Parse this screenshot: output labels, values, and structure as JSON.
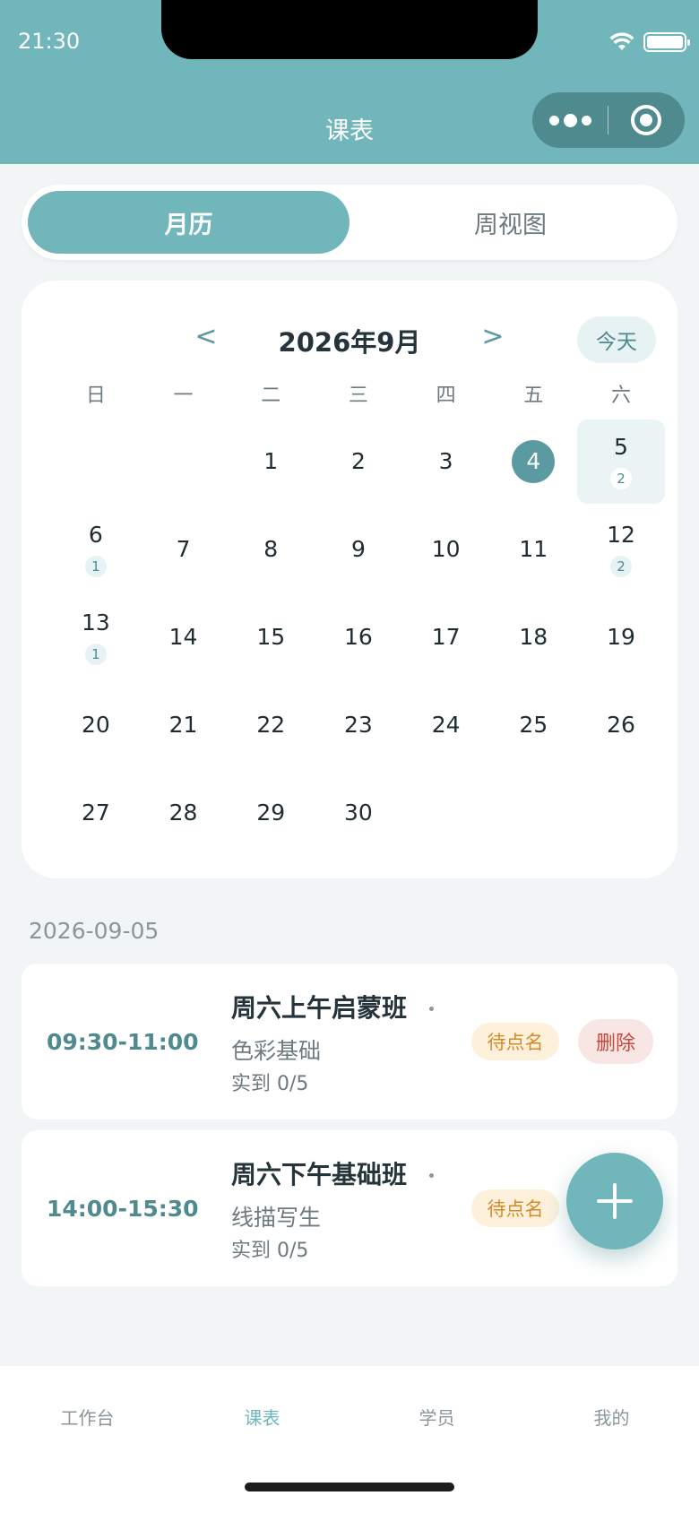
{
  "status_bar": {
    "time": "21:30"
  },
  "header": {
    "title": "课表"
  },
  "view_toggle": {
    "month_label": "月历",
    "week_label": "周视图",
    "active": "month"
  },
  "calendar": {
    "month_title": "2026年9月",
    "prev_symbol": "<",
    "next_symbol": ">",
    "today_label": "今天",
    "weekdays": [
      "日",
      "一",
      "二",
      "三",
      "四",
      "五",
      "六"
    ],
    "leading_blanks": 2,
    "days_in_month": 30,
    "today": 4,
    "selected": 5,
    "lesson_counts": {
      "5": 2,
      "6": 1,
      "12": 2,
      "13": 1
    }
  },
  "selected_date_label": "2026-09-05",
  "lessons": [
    {
      "time": "09:30-11:00",
      "name": "周六上午启蒙班",
      "course": "色彩基础",
      "attendance": "实到 0/5",
      "status": "待点名",
      "action": "删除"
    },
    {
      "time": "14:00-15:30",
      "name": "周六下午基础班",
      "course": "线描写生",
      "attendance": "实到 0/5",
      "status": "待点名"
    }
  ],
  "tabbar": {
    "items": [
      "工作台",
      "课表",
      "学员",
      "我的"
    ],
    "active_index": 1
  },
  "colors": {
    "primary": "#71b6bb",
    "primary_dark": "#4f8a8e",
    "pending": "#d58a2a",
    "danger": "#c9463b"
  }
}
